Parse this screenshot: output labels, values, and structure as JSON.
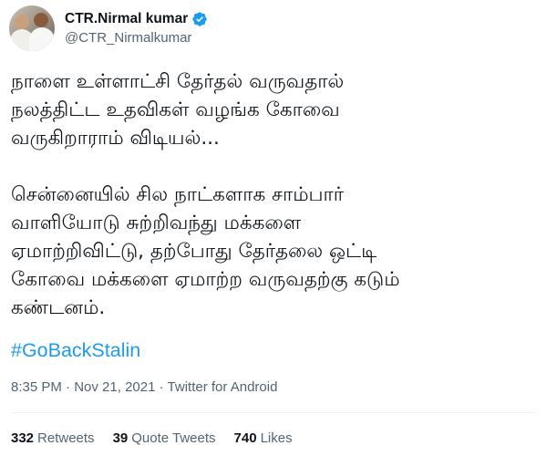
{
  "author": {
    "name": "CTR.Nirmal kumar",
    "handle": "@CTR_Nirmalkumar",
    "verified": true,
    "verified_color": "#1d9bf0"
  },
  "tweet": {
    "paragraph_1_lines": [
      "நாளை உள்ளாட்சி தேர்தல் வருவதால்",
      "நலத்திட்ட உதவிகள் வழங்க கோவை",
      "வருகிறாராம் விடியல்..."
    ],
    "paragraph_2_lines": [
      "சென்னையில் சில நாட்களாக சாம்பார்",
      "வாளியோடு சுற்றிவந்து மக்களை",
      "ஏமாற்றிவிட்டு, தற்போது தேர்தலை ஒட்டி",
      "கோவை மக்களை ஏமாற்ற வருவதற்கு கடும்",
      "கண்டனம்."
    ],
    "hashtag": "#GoBackStalin",
    "hashtag_color": "#1d9bf0"
  },
  "meta": {
    "time": "8:35 PM",
    "separator_1": "·",
    "date": "Nov 21, 2021",
    "separator_2": "·",
    "source": "Twitter for Android"
  },
  "stats": {
    "retweets_count": "332",
    "retweets_label": "Retweets",
    "quote_count": "39",
    "quote_label": "Quote Tweets",
    "likes_count": "740",
    "likes_label": "Likes"
  }
}
